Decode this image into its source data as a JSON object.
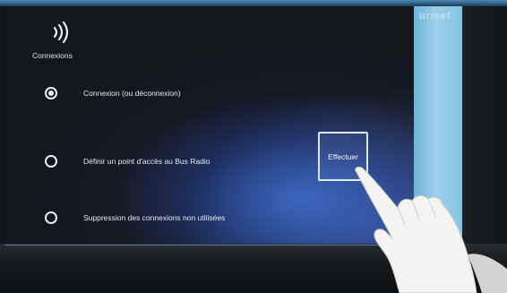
{
  "brand": "urmet",
  "header": {
    "icon": "wireless-signal-icon",
    "title": "Connexions"
  },
  "options": [
    {
      "label": "Connexion (ou déconnexion)",
      "selected": true
    },
    {
      "label": "Définir un point d'accès au Bus Radio",
      "selected": false
    },
    {
      "label": "Suppression des connexions non utilisées",
      "selected": false
    }
  ],
  "action_button": {
    "label": "Effectuer"
  },
  "colors": {
    "screen_glow": "#3c6ed2",
    "side_panel": "#8fc9e6",
    "text": "#e3ebf5"
  }
}
